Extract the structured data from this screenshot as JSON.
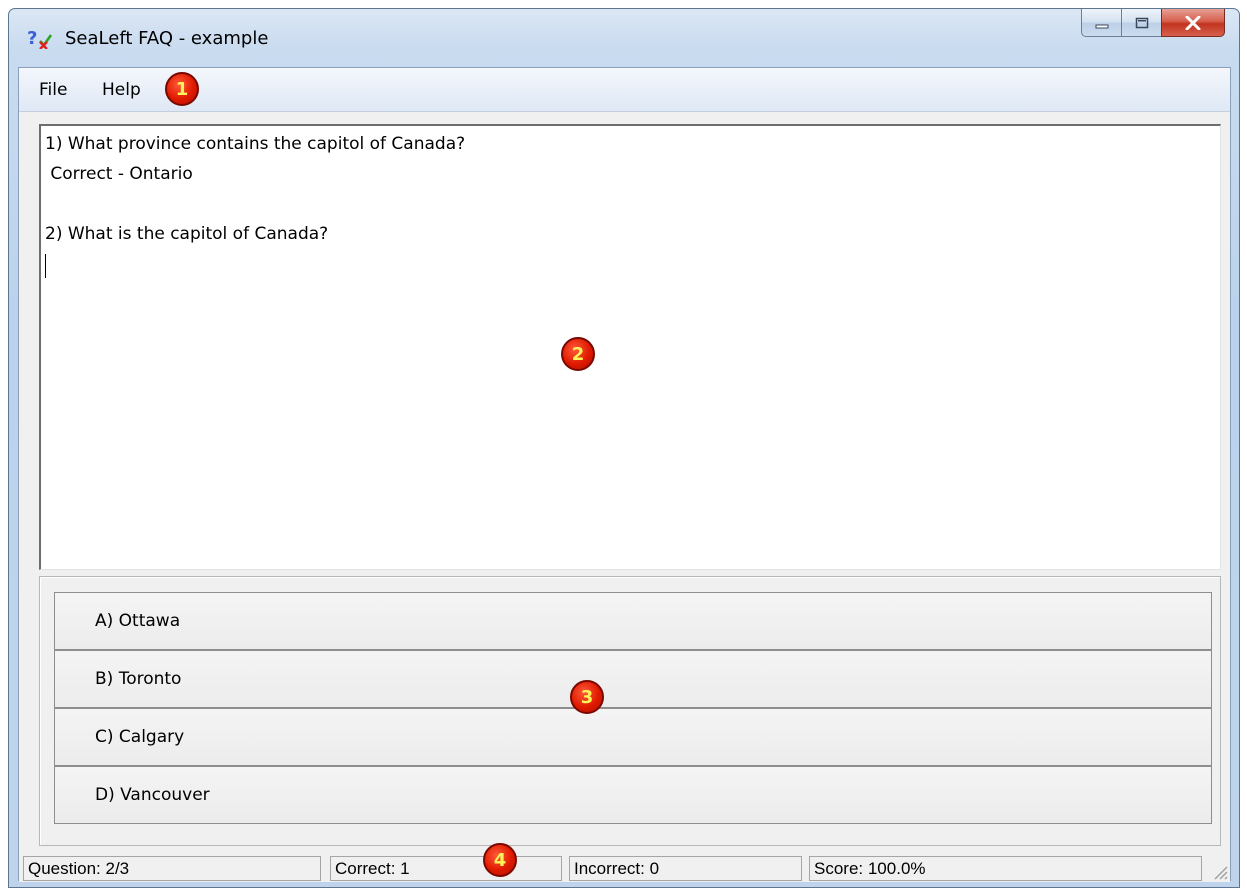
{
  "window": {
    "title": "SeaLeft FAQ - example",
    "icons": [
      "app-icon",
      "minimize-icon",
      "maximize-icon",
      "close-icon"
    ]
  },
  "menu": {
    "items": [
      "File",
      "Help"
    ]
  },
  "callouts": [
    "1",
    "2",
    "3",
    "4"
  ],
  "quiz_text": {
    "lines": [
      "1) What province contains the capitol of Canada?",
      " Correct - Ontario",
      "",
      "2) What is the capitol of Canada?"
    ]
  },
  "answers": [
    "A) Ottawa",
    "B) Toronto",
    "C) Calgary",
    "D) Vancouver"
  ],
  "status": {
    "question": "Question: 2/3",
    "correct": "Correct: 1",
    "incorrect": "Incorrect: 0",
    "score": "Score: 100.0%"
  },
  "colors": {
    "badge_fill": "#e01a00",
    "badge_text": "#fff35a",
    "close_button": "#c1341f"
  }
}
